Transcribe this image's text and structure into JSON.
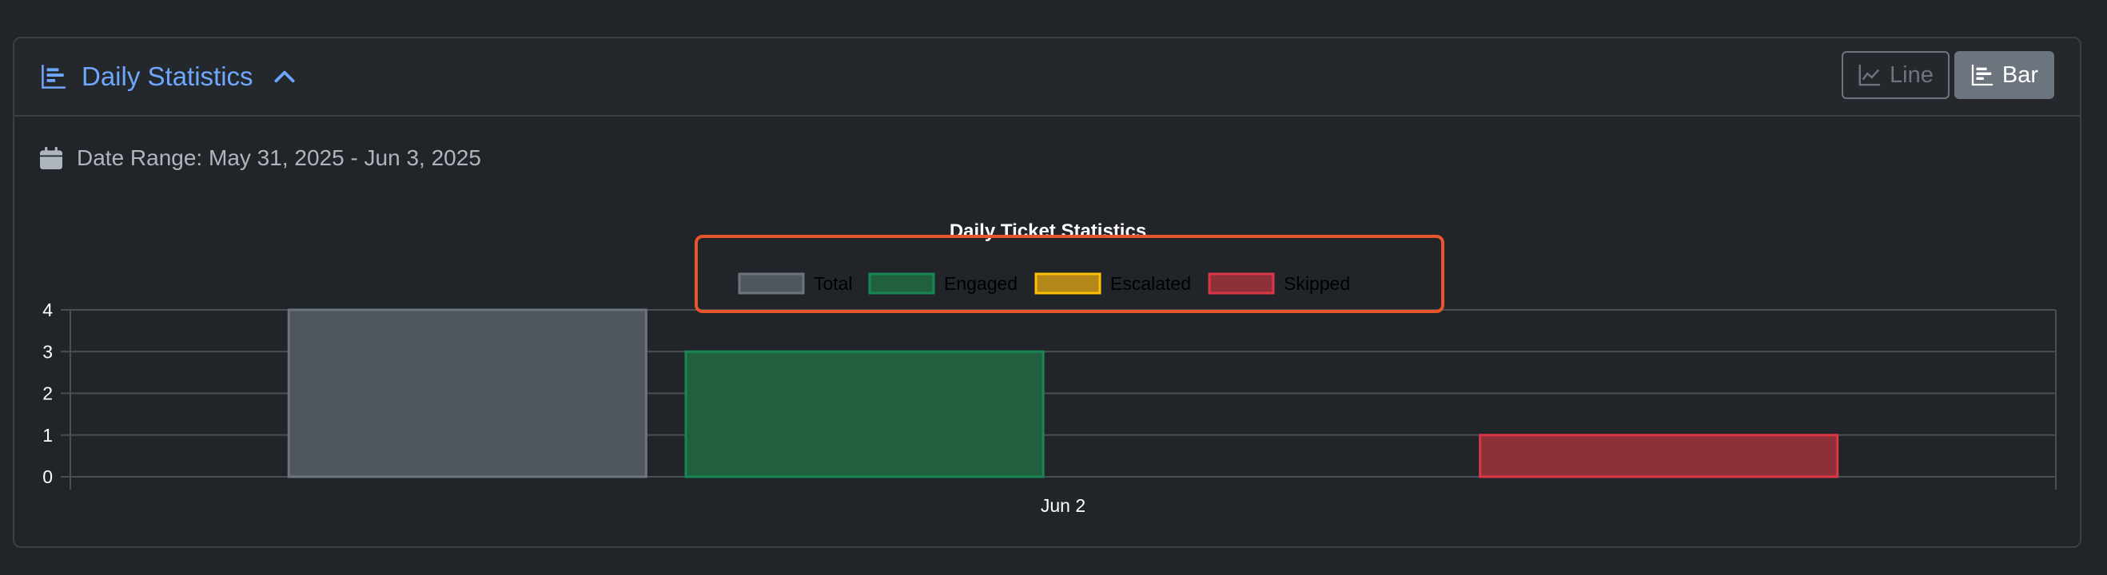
{
  "header": {
    "title": "Daily Statistics",
    "toggle": {
      "line_label": "Line",
      "bar_label": "Bar",
      "selected": "Bar"
    }
  },
  "date_range": {
    "label": "Date Range: May 31, 2025 - Jun 3, 2025"
  },
  "colors": {
    "accent": "#6ea8fe",
    "highlight_box": "#e8552a"
  },
  "icons": {
    "title_icon": "bar-chart-icon",
    "collapse_icon": "chevron-up-icon",
    "line_icon": "line-chart-icon",
    "bar_icon": "bar-chart-icon",
    "date_icon": "calendar-icon"
  },
  "chart_data": {
    "type": "bar",
    "title": "Daily Ticket Statistics",
    "categories": [
      "Jun 2"
    ],
    "series": [
      {
        "name": "Total",
        "values": [
          4
        ],
        "fill": "#50565d",
        "stroke": "#6c757d"
      },
      {
        "name": "Engaged",
        "values": [
          3
        ],
        "fill": "#20603f",
        "stroke": "#198754"
      },
      {
        "name": "Escalated",
        "values": [
          0
        ],
        "fill": "#b3871a",
        "stroke": "#ffc107"
      },
      {
        "name": "Skipped",
        "values": [
          1
        ],
        "fill": "#8e303a",
        "stroke": "#dc3545"
      }
    ],
    "ylim": [
      0,
      4
    ],
    "yticks": [
      0,
      1,
      2,
      3,
      4
    ],
    "grid": true,
    "legend_position": "top-center",
    "legend_highlighted": true
  }
}
